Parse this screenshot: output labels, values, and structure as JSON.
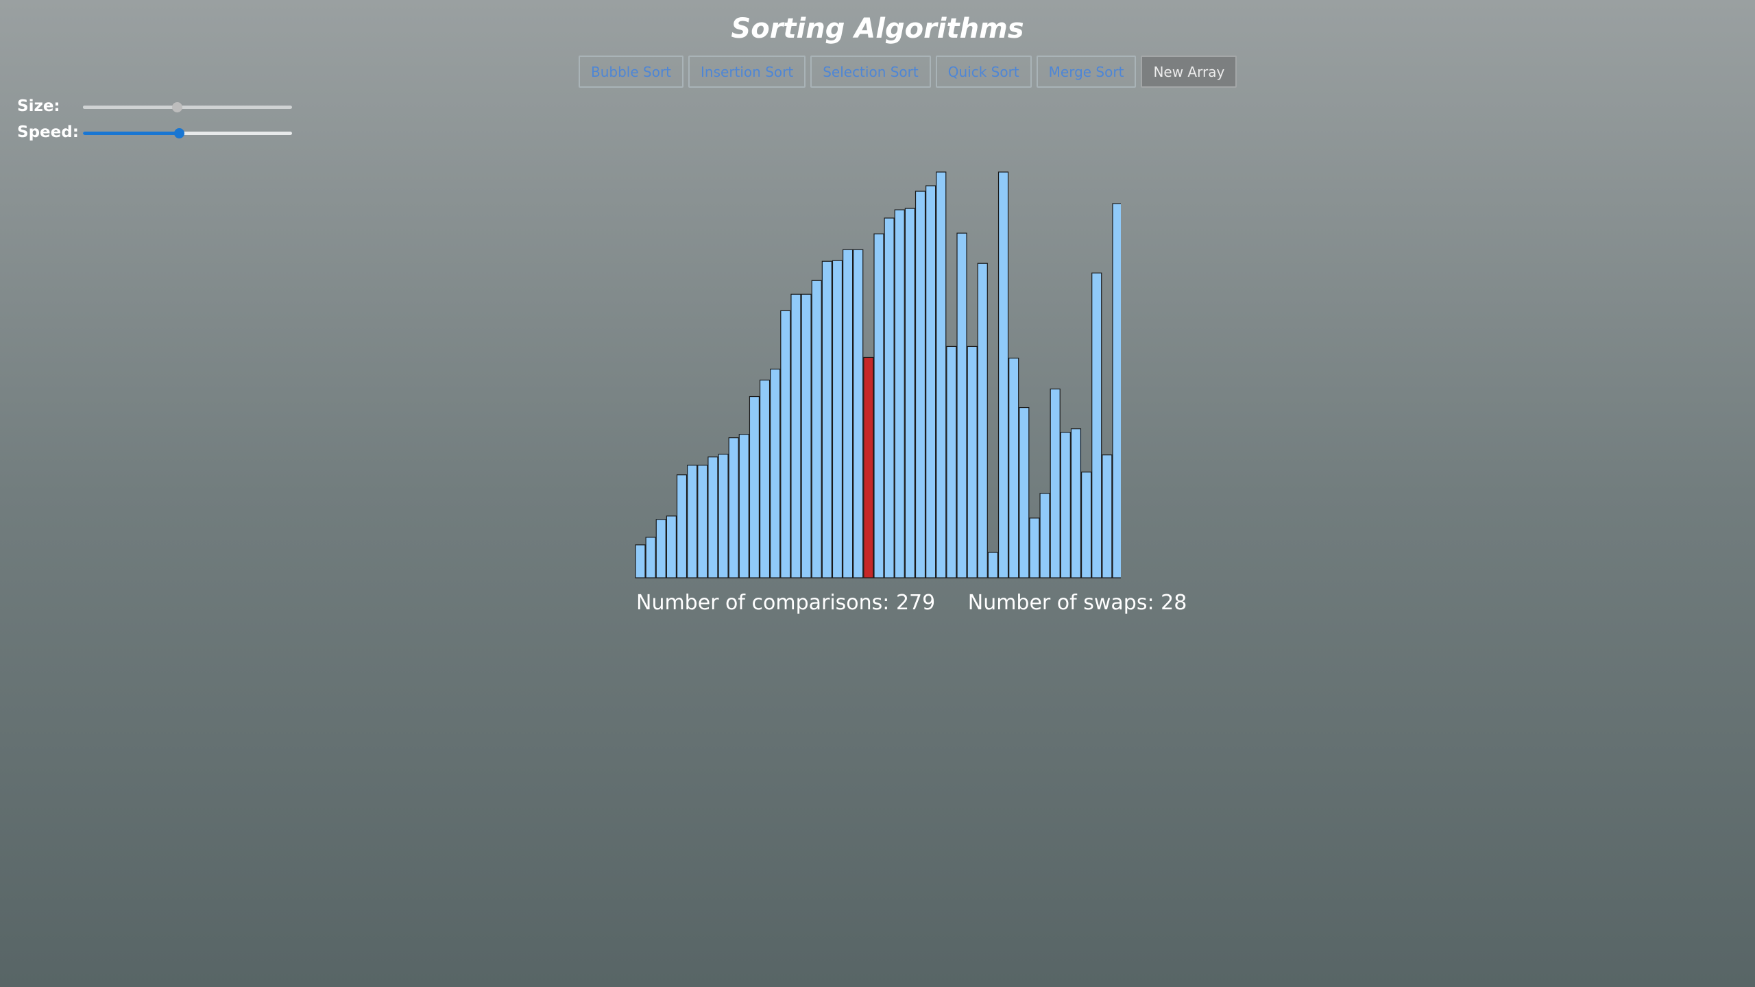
{
  "app": {
    "title": "Sorting Algorithms"
  },
  "toolbar": {
    "buttons": [
      {
        "label": "Bubble Sort"
      },
      {
        "label": "Insertion Sort"
      },
      {
        "label": "Selection Sort"
      },
      {
        "label": "Quick Sort"
      },
      {
        "label": "Merge Sort"
      },
      {
        "label": "New Array"
      }
    ]
  },
  "controls": {
    "size": {
      "label": "Size:",
      "value_fraction": 0.45
    },
    "speed": {
      "label": "Speed:",
      "value_fraction": 0.46
    }
  },
  "colors": {
    "bar": "#90caf9",
    "bar_active": "#c62828",
    "bar_border": "#1a1a1a",
    "slider_active": "#1976d2",
    "slider_inactive": "#cfd2d3"
  },
  "array": {
    "values": [
      48,
      59,
      85,
      90,
      150,
      164,
      164,
      176,
      180,
      204,
      209,
      264,
      288,
      304,
      389,
      413,
      413,
      433,
      461,
      462,
      478,
      478,
      321,
      501,
      524,
      536,
      538,
      563,
      571,
      591,
      337,
      502,
      337,
      458,
      37,
      591,
      320,
      248,
      87,
      123,
      275,
      212,
      217,
      154,
      444,
      179,
      545
    ],
    "active_index": 22,
    "max_value": 591
  },
  "stats": {
    "comparisons_label": "Number of comparisons: 279",
    "swaps_label": "Number of swaps: 28"
  }
}
